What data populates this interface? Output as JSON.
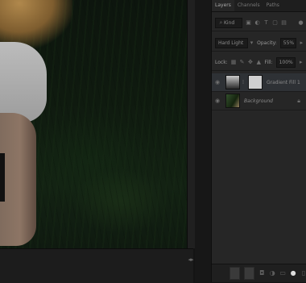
{
  "panel": {
    "tabs": [
      {
        "label": "Layers",
        "active": true
      },
      {
        "label": "Channels",
        "active": false
      },
      {
        "label": "Paths",
        "active": false
      }
    ],
    "filter": {
      "kind_label": "Kind"
    },
    "blend_mode": "Hard Light",
    "opacity": {
      "label": "Opacity:",
      "value": "55%"
    },
    "lock": {
      "label": "Lock:"
    },
    "fill": {
      "label": "Fill:",
      "value": "100%"
    },
    "layers": [
      {
        "name": "Gradient Fill 1",
        "visible": true,
        "selected": true
      },
      {
        "name": "Background",
        "visible": true,
        "selected": false,
        "locked": true
      }
    ]
  },
  "colors": {
    "panel_bg": "#262626",
    "selected_layer": "#2e3135",
    "canvas_dark": "#0f1a0f"
  },
  "icons": {
    "eye": "eye-icon",
    "lock": "lock-icon",
    "link": "link-icon",
    "fx": "fx-icon",
    "mask": "mask-icon",
    "adjust": "adjustment-icon",
    "folder": "folder-icon",
    "new": "new-layer-icon",
    "trash": "trash-icon"
  }
}
